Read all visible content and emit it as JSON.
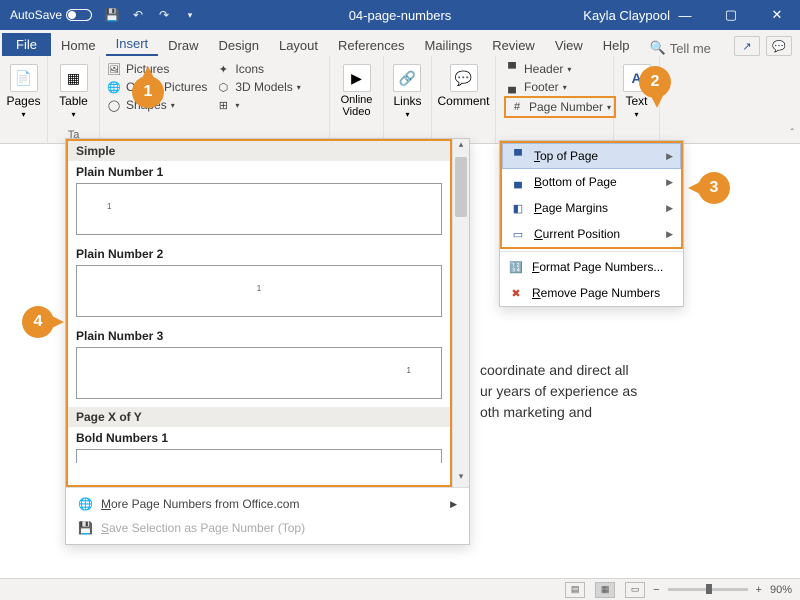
{
  "titlebar": {
    "autosave": "AutoSave",
    "doc": "04-page-numbers",
    "user": "Kayla Claypool"
  },
  "tabs": {
    "file": "File",
    "home": "Home",
    "insert": "Insert",
    "draw": "Draw",
    "design": "Design",
    "layout": "Layout",
    "references": "References",
    "mailings": "Mailings",
    "review": "Review",
    "view": "View",
    "help": "Help",
    "tellme": "Tell me"
  },
  "ribbon": {
    "pages": "Pages",
    "table": "Table",
    "tables": "Ta",
    "pictures": "Pictures",
    "online_pictures": "Online Pictures",
    "shapes": "Shapes",
    "icons": "Icons",
    "models": "3D Models",
    "online_video": "Online Video",
    "links": "Links",
    "comment": "Comment",
    "header": "Header",
    "footer": "Footer",
    "page_number": "Page Number",
    "text": "Text"
  },
  "pnmenu": {
    "top": "Top of Page",
    "bottom": "Bottom of Page",
    "margins": "Page Margins",
    "current": "Current Position",
    "format": "Format Page Numbers...",
    "remove": "Remove Page Numbers"
  },
  "gallery": {
    "cat_simple": "Simple",
    "p1": "Plain Number 1",
    "p2": "Plain Number 2",
    "p3": "Plain Number 3",
    "cat_xy": "Page X of Y",
    "bold1": "Bold Numbers 1",
    "more": "More Page Numbers from Office.com",
    "save_sel": "Save Selection as Page Number (Top)"
  },
  "doc_snip": {
    "l1": " coordinate and direct all",
    "l2": "ur years of experience as",
    "l3": "oth marketing and"
  },
  "status": {
    "zoom": "90%"
  },
  "callouts": {
    "a": "1",
    "b": "2",
    "c": "3",
    "d": "4"
  }
}
